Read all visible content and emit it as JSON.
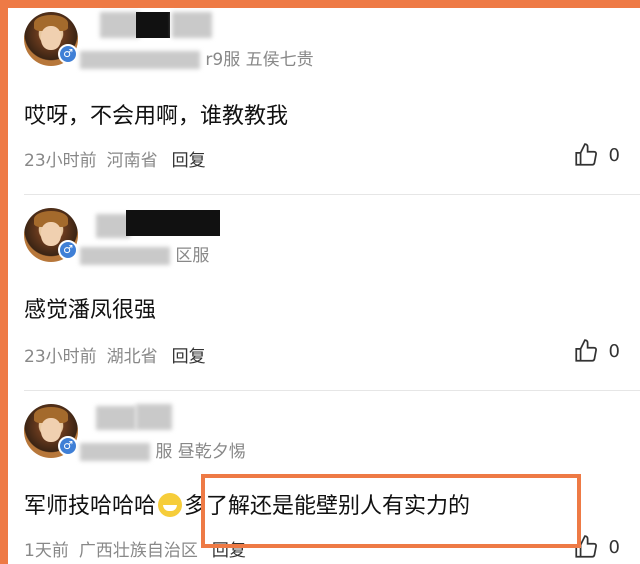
{
  "comments": [
    {
      "user_suffix": "r9服 五侯七贵",
      "text": "哎呀，不会用啊，谁教教我",
      "time": "23小时前",
      "location": "河南省",
      "reply_label": "回复",
      "likes": "0"
    },
    {
      "user_suffix": "区服",
      "text": "感觉潘凤很强",
      "time": "23小时前",
      "location": "湖北省",
      "reply_label": "回复",
      "likes": "0"
    },
    {
      "user_suffix": "服 昼乾夕惕",
      "text_before": "军师技哈哈哈",
      "text_after": "多了解还是能壁别人有实力的",
      "time": "1天前",
      "location": "广西壮族自治区",
      "reply_label": "回复",
      "likes": "0"
    }
  ],
  "colors": {
    "accent_border": "#ee7a45",
    "badge": "#3f7fd6"
  },
  "icons": {
    "like": "thumbs-up-icon",
    "gender": "male-icon",
    "emoji": "grinning-emoji-icon"
  }
}
